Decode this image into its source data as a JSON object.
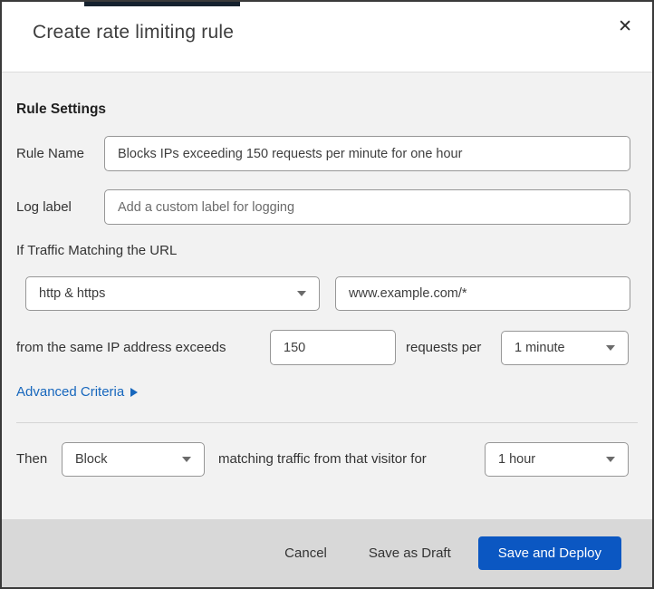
{
  "dialog": {
    "title": "Create rate limiting rule",
    "close_icon": "✕"
  },
  "rule_settings": {
    "heading": "Rule Settings",
    "rule_name": {
      "label": "Rule Name",
      "value": "Blocks IPs exceeding 150 requests per minute for one hour"
    },
    "log_label": {
      "label": "Log label",
      "placeholder": "Add a custom label for logging"
    }
  },
  "match": {
    "heading": "If Traffic Matching the URL",
    "scheme": "http & https",
    "url": "www.example.com/*",
    "threshold_prefix": "from the same IP address exceeds",
    "threshold_count": "150",
    "threshold_middle": "requests per",
    "period": "1 minute",
    "advanced_link": "Advanced Criteria"
  },
  "action": {
    "prefix": "Then",
    "action_value": "Block",
    "middle": "matching traffic from that visitor for",
    "duration": "1 hour"
  },
  "footer": {
    "cancel": "Cancel",
    "save_draft": "Save as Draft",
    "save_deploy": "Save and Deploy"
  },
  "colors": {
    "primary_button": "#0b57c2",
    "link": "#1767bd"
  }
}
